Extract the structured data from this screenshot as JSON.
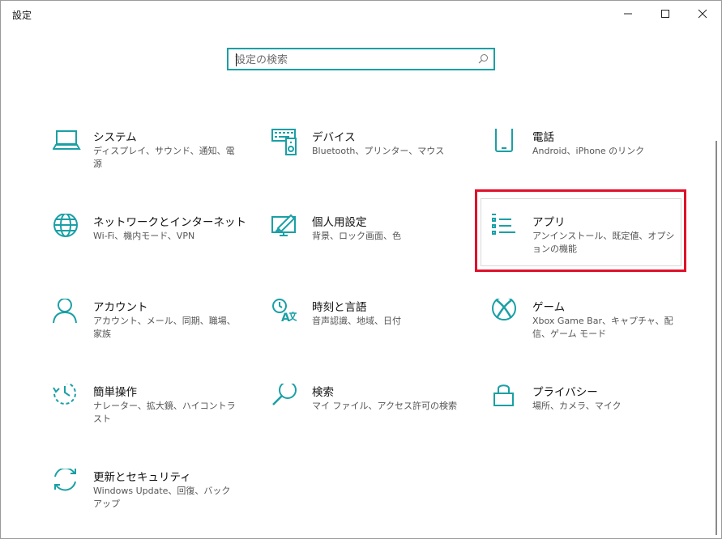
{
  "window": {
    "title": "設定",
    "controls": {
      "minimize": "minimize-icon",
      "maximize": "maximize-icon",
      "close": "close-icon"
    }
  },
  "search": {
    "placeholder": "設定の検索",
    "value": ""
  },
  "accent_color": "#1aa0a5",
  "highlight_color": "#e0102a",
  "tiles": [
    {
      "name": "システム",
      "desc": "ディスプレイ、サウンド、通知、電源",
      "icon": "laptop-icon"
    },
    {
      "name": "デバイス",
      "desc": "Bluetooth、プリンター、マウス",
      "icon": "keyboard-icon"
    },
    {
      "name": "電話",
      "desc": "Android、iPhone のリンク",
      "icon": "phone-icon"
    },
    {
      "name": "ネットワークとインターネット",
      "desc": "Wi-Fi、機内モード、VPN",
      "icon": "globe-icon"
    },
    {
      "name": "個人用設定",
      "desc": "背景、ロック画面、色",
      "icon": "paint-icon"
    },
    {
      "name": "アプリ",
      "desc": "アンインストール、既定値、オプションの機能",
      "icon": "apps-list-icon"
    },
    {
      "name": "アカウント",
      "desc": "アカウント、メール、同期、職場、家族",
      "icon": "person-icon"
    },
    {
      "name": "時刻と言語",
      "desc": "音声認識、地域、日付",
      "icon": "time-language-icon"
    },
    {
      "name": "ゲーム",
      "desc": "Xbox Game Bar、キャプチャ、配信、ゲーム モード",
      "icon": "xbox-icon"
    },
    {
      "name": "簡単操作",
      "desc": "ナレーター、拡大鏡、ハイコントラスト",
      "icon": "ease-of-access-icon"
    },
    {
      "name": "検索",
      "desc": "マイ ファイル、アクセス許可の検索",
      "icon": "search-icon"
    },
    {
      "name": "プライバシー",
      "desc": "場所、カメラ、マイク",
      "icon": "lock-icon"
    },
    {
      "name": "更新とセキュリティ",
      "desc": "Windows Update、回復、バックアップ",
      "icon": "sync-icon"
    }
  ]
}
